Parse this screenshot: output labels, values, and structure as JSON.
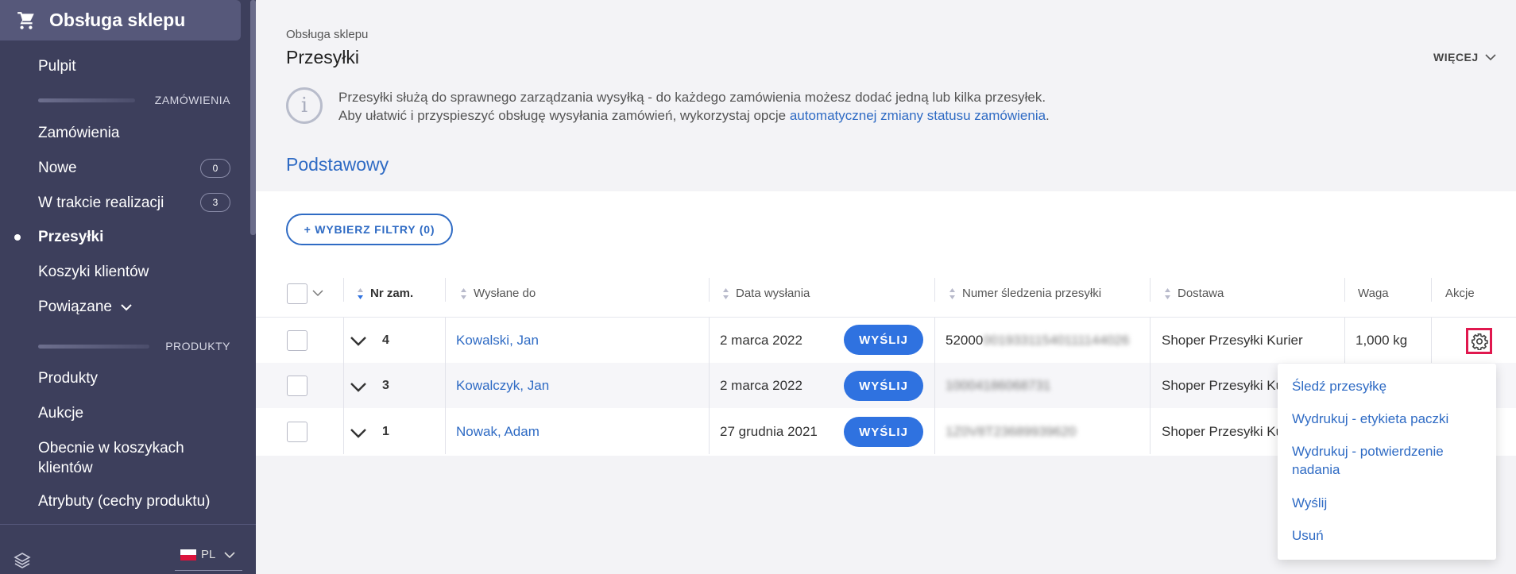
{
  "sidebar": {
    "header": "Obsługa sklepu",
    "items": {
      "pulpit": "Pulpit",
      "zamowienia": "Zamówienia",
      "nowe": "Nowe",
      "w_trakcie": "W trakcie realizacji",
      "przesylki": "Przesyłki",
      "koszyki": "Koszyki klientów",
      "powiazane": "Powiązane",
      "produkty": "Produkty",
      "aukcje": "Aukcje",
      "obecnie": "Obecnie w koszykach klientów",
      "atrybuty": "Atrybuty (cechy produktu)"
    },
    "badges": {
      "nowe": "0",
      "w_trakcie": "3"
    },
    "sections": {
      "orders": "ZAMÓWIENIA",
      "products": "PRODUKTY"
    },
    "language": "PL"
  },
  "header": {
    "breadcrumb": "Obsługa sklepu",
    "title": "Przesyłki",
    "more": "WIĘCEJ"
  },
  "info": {
    "line1": "Przesyłki służą do sprawnego zarządzania wysyłką - do każdego zamówienia możesz dodać jedną lub kilka przesyłek.",
    "line2_prefix": "Aby ułatwić i przyspieszyć obsługę wysyłania zamówień, wykorzystaj opcje ",
    "line2_link": "automatycznej zmiany statusu zamówienia",
    "line2_suffix": "."
  },
  "section_title": "Podstawowy",
  "filter_button": "+ WYBIERZ FILTRY (0)",
  "table": {
    "columns": {
      "nr": "Nr zam.",
      "sent_to": "Wysłane do",
      "date": "Data wysłania",
      "tracking": "Numer śledzenia przesyłki",
      "delivery": "Dostawa",
      "weight": "Waga",
      "actions": "Akcje"
    },
    "send_label": "WYŚLIJ",
    "rows": [
      {
        "nr": "4",
        "sent_to": "Kowalski, Jan",
        "date": "2 marca 2022",
        "tracking_visible": "52000",
        "tracking_blurred": "00193311540111144026",
        "delivery": "Shoper Przesyłki Kurier",
        "weight": "1,000 kg"
      },
      {
        "nr": "3",
        "sent_to": "Kowalczyk, Jan",
        "date": "2 marca 2022",
        "tracking_visible": "",
        "tracking_blurred": "10004186068731",
        "delivery": "Shoper Przesyłki Ku",
        "weight": ""
      },
      {
        "nr": "1",
        "sent_to": "Nowak, Adam",
        "date": "27 grudnia 2021",
        "tracking_visible": "",
        "tracking_blurred": "1Z0V8T23689939620",
        "delivery": "Shoper Przesyłki Ku",
        "weight": ""
      }
    ]
  },
  "action_menu": {
    "track": "Śledź przesyłkę",
    "print_label": "Wydrukuj - etykieta paczki",
    "print_confirmation": "Wydrukuj - potwierdzenie nadania",
    "send": "Wyślij",
    "delete": "Usuń"
  },
  "colors": {
    "sidebar_bg": "#3d3f5c",
    "accent": "#2f6bc4",
    "button": "#2f72e0",
    "highlight": "#e0184e"
  }
}
